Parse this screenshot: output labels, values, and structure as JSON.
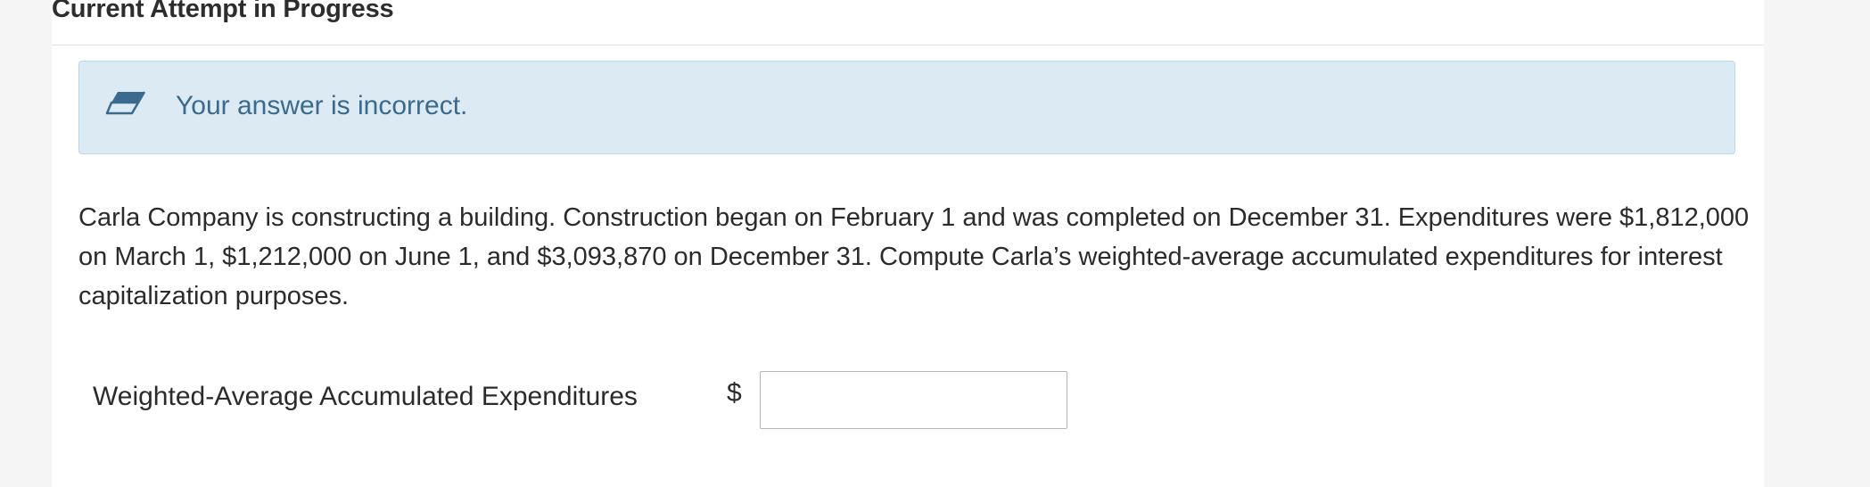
{
  "section": {
    "title": "Current Attempt in Progress"
  },
  "feedback": {
    "icon": "eraser-icon",
    "message": "Your answer is incorrect.",
    "colors": {
      "background": "#dceaf4",
      "border": "#b9d7ea",
      "text": "#3a6a8e"
    }
  },
  "question": {
    "text": "Carla Company is constructing a building. Construction began on February 1 and was completed on December 31. Expenditures were $1,812,000 on March 1, $1,212,000 on June 1, and $3,093,870 on December 31. Compute Carla’s weighted-average accumulated expenditures for interest capitalization purposes."
  },
  "answer": {
    "label": "Weighted-Average Accumulated Expenditures",
    "currency_symbol": "$",
    "value": "",
    "placeholder": ""
  }
}
